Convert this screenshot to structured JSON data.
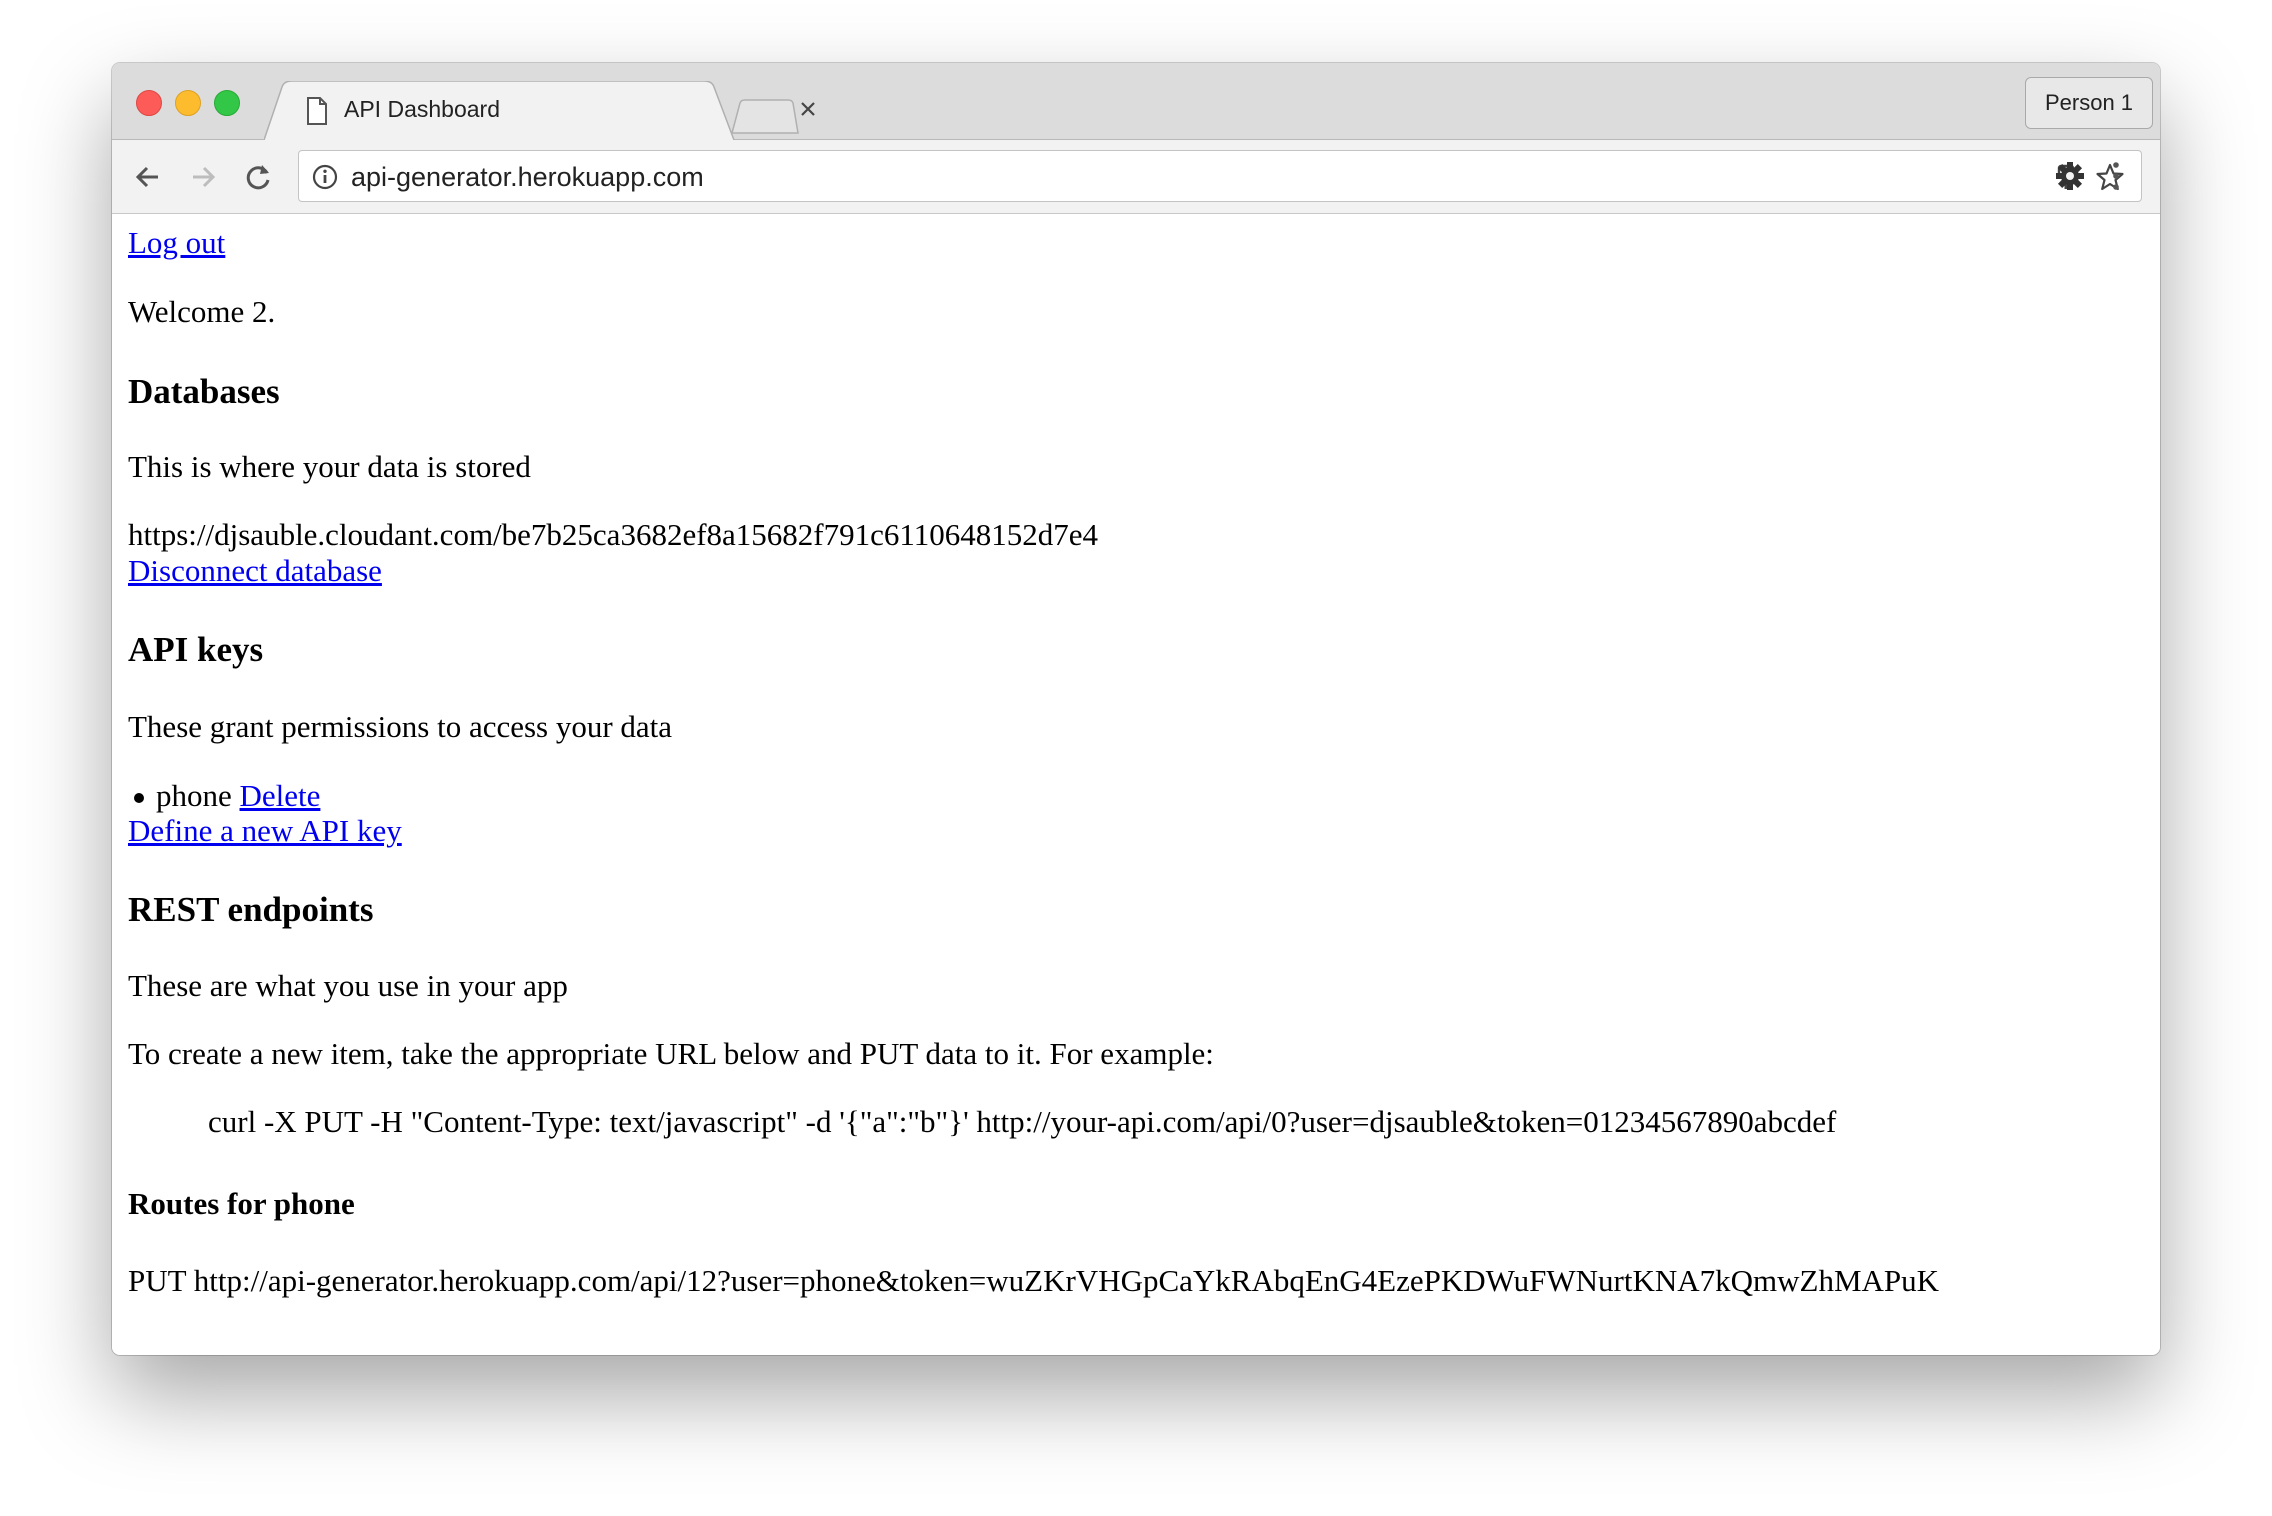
{
  "browser": {
    "tab_title": "API Dashboard",
    "profile_label": "Person 1",
    "url": "api-generator.herokuapp.com"
  },
  "page": {
    "logout_label": "Log out",
    "welcome": "Welcome 2.",
    "databases": {
      "heading": "Databases",
      "description": "This is where your data is stored",
      "db_url": "https://djsauble.cloudant.com/be7b25ca3682ef8a15682f791c6110648152d7e4",
      "disconnect_label": "Disconnect database"
    },
    "api_keys": {
      "heading": "API keys",
      "description": "These grant permissions to access your data",
      "keys": [
        {
          "name": "phone",
          "delete_label": "Delete"
        }
      ],
      "define_label": "Define a new API key"
    },
    "rest": {
      "heading": "REST endpoints",
      "description": "These are what you use in your app",
      "instructions": "To create a new item, take the appropriate URL below and PUT data to it. For example:",
      "example": "curl -X PUT -H \"Content-Type: text/javascript\" -d '{\"a\":\"b\"}' http://your-api.com/api/0?user=djsauble&token=01234567890abcdef",
      "routes_heading": "Routes for phone",
      "route": "PUT http://api-generator.herokuapp.com/api/12?user=phone&token=wuZKrVHGpCaYkRAbqEnG4EzePKDWuFWNurtKNA7kQmwZhMAPuK"
    }
  }
}
